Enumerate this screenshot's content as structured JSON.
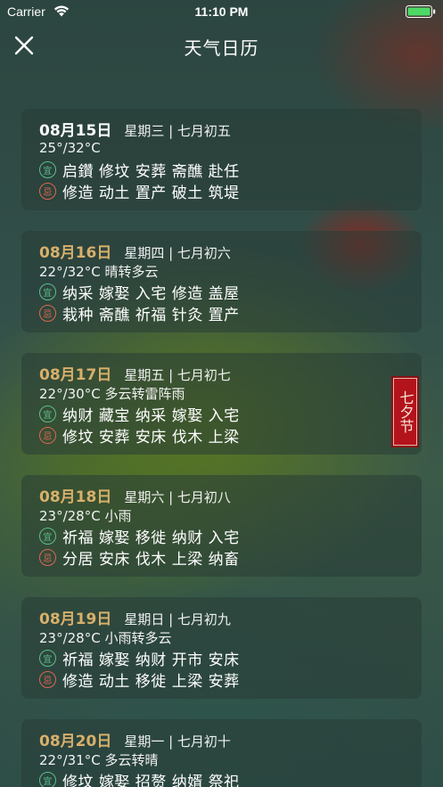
{
  "status_bar": {
    "carrier": "Carrier",
    "time": "11:10 PM"
  },
  "nav": {
    "title": "天气日历"
  },
  "badges": {
    "yi": "宜",
    "ji": "忌"
  },
  "colors": {
    "accent_date": "#d8b06a",
    "yi": "#5cc08a",
    "ji": "#e0674e",
    "festival": "#b3141c"
  },
  "days": [
    {
      "date": "08月15日",
      "week": "星期三 | 七月初五",
      "weather": "25°/32°C",
      "yi": "启鑽 修坟 安葬 斋醮 赴任",
      "ji": "修造 动土 置产 破土 筑堤",
      "festival": ""
    },
    {
      "date": "08月16日",
      "week": "星期四 | 七月初六",
      "weather": "22°/32°C 晴转多云",
      "yi": "纳采 嫁娶 入宅 修造 盖屋",
      "ji": "栽种 斋醮 祈福 针灸 置产",
      "festival": ""
    },
    {
      "date": "08月17日",
      "week": "星期五 | 七月初七",
      "weather": "22°/30°C 多云转雷阵雨",
      "yi": "纳财 藏宝 纳采 嫁娶 入宅",
      "ji": "修坟 安葬 安床 伐木 上梁",
      "festival": "七夕节"
    },
    {
      "date": "08月18日",
      "week": "星期六 | 七月初八",
      "weather": "23°/28°C 小雨",
      "yi": "祈福 嫁娶 移徙 纳财 入宅",
      "ji": "分居 安床 伐木 上梁 纳畜",
      "festival": ""
    },
    {
      "date": "08月19日",
      "week": "星期日 | 七月初九",
      "weather": "23°/28°C 小雨转多云",
      "yi": "祈福 嫁娶 纳财 开市 安床",
      "ji": "修造 动土 移徙 上梁 安葬",
      "festival": ""
    },
    {
      "date": "08月20日",
      "week": "星期一 | 七月初十",
      "weather": "22°/31°C 多云转晴",
      "yi": "修坟 嫁娶 招赘 纳婿 祭祀",
      "ji": "",
      "festival": ""
    }
  ]
}
